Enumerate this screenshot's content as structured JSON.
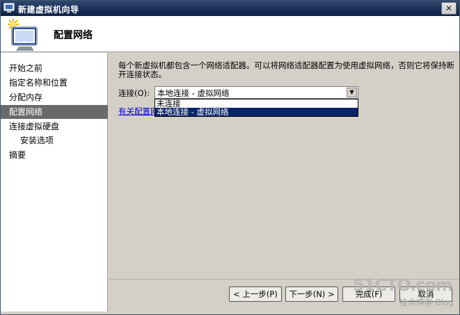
{
  "window": {
    "title": "新建虚拟机向导",
    "close_label": "✕"
  },
  "header": {
    "title": "配置网络"
  },
  "sidebar": {
    "items": [
      {
        "label": "开始之前"
      },
      {
        "label": "指定名称和位置"
      },
      {
        "label": "分配内存"
      },
      {
        "label": "配置网络"
      },
      {
        "label": "连接虚拟硬盘"
      },
      {
        "label": "安装选项"
      },
      {
        "label": "摘要"
      }
    ],
    "active_index": 3
  },
  "main": {
    "description": "每个新虚拟机都包含一个网络适配器。可以将网络适配器配置为使用虚拟网络，否则它将保持断开连接状态。",
    "connection_label": "连接(O):",
    "connection_value": "本地连接 - 虚拟网络",
    "dropdown_options": [
      "未连接",
      "本地连接 - 虚拟网络"
    ],
    "selected_option_index": 1,
    "help_link": "有关配置网络的详细信息"
  },
  "buttons": {
    "back": "< 上一步(P)",
    "next": "下一步(N) >",
    "finish": "完成(F)",
    "cancel": "取消"
  },
  "watermark": {
    "brand": "51CTO.com",
    "tagline": "技术博客 Blog"
  },
  "colors": {
    "selection": "#0a246a",
    "active_nav": "#6a6a6a",
    "link": "#0000cc"
  }
}
